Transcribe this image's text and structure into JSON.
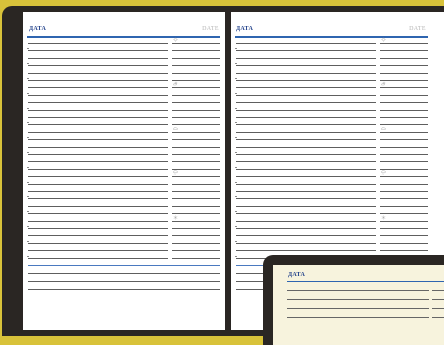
{
  "planner": {
    "left_page": {
      "title": "ДАТА",
      "date_label": "DATE"
    },
    "right_page": {
      "title": "ДАТА",
      "date_label": "DATE"
    },
    "corner_page": {
      "title": "ДАТА"
    },
    "side_icons": [
      "sun-icon",
      "cloud-sun-icon",
      "cloud-icon",
      "rain-icon",
      "snow-icon"
    ],
    "colors": {
      "background": "#d8c23a",
      "cover": "#2a2623",
      "paper": "#ffffff",
      "cream_paper": "#f7f3dd",
      "accent_blue": "#2f65b0"
    }
  }
}
